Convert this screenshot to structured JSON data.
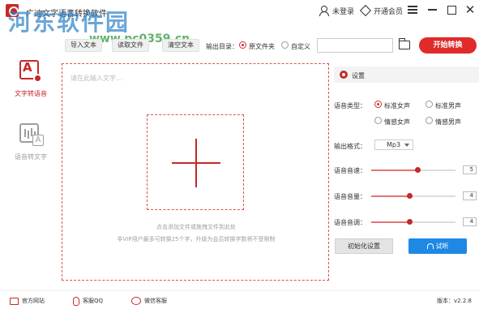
{
  "window": {
    "title": "广迪文字语音转换软件",
    "watermark": "河东软件园",
    "watermark_url": "www.pc0359.cn"
  },
  "header": {
    "login_label": "未登录",
    "vip_label": "开通会员"
  },
  "toolbar": {
    "import_label": "导入文本",
    "import_label2": "读取文件",
    "clear_label": "清空文本",
    "output_label": "输出目录：",
    "opt_source": "原文件夹",
    "opt_custom": "自定义",
    "path_value": "",
    "start_label": "开始转换"
  },
  "sidebar": {
    "items": [
      {
        "label": "文字转语音",
        "active": true
      },
      {
        "label": "语音转文字",
        "active": false
      }
    ]
  },
  "editor": {
    "placeholder": "请在此输入文字...",
    "hint_drop": "点击添加文件或拖拽文件到此处",
    "hint_limit": "非VIP用户最多可转换25个字，升级为会员转换字数将不受限制"
  },
  "settings": {
    "title": "设置",
    "voice_type_label": "语音类型：",
    "voice_options": [
      "标准女声",
      "标准男声",
      "情感女声",
      "情感男声"
    ],
    "voice_selected": "标准女声",
    "format_label": "输出格式：",
    "format_value": "Mp3",
    "speed_label": "语音音速：",
    "speed_value": "5",
    "speed_fraction": 0.55,
    "volume_label": "语音音量：",
    "volume_value": "4",
    "volume_fraction": 0.45,
    "pitch_label": "语音音调：",
    "pitch_value": "4",
    "pitch_fraction": 0.45,
    "reset_label": "初始化设置",
    "listen_label": "试听"
  },
  "footer": {
    "website_label": "官方网站",
    "qq_label": "客服QQ",
    "wechat_label": "微信客服",
    "version_label": "版本：v2.2.8"
  },
  "colors": {
    "accent": "#e02b2b",
    "listen": "#1e88e5"
  }
}
